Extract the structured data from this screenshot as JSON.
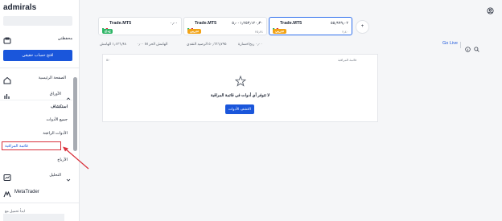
{
  "sidebar": {
    "brand": "admirals",
    "wallet_label": "محفظتي",
    "open_account_label": "افتح حساب حقيقي",
    "nav": {
      "dashboard": "الصفحة الرئيسية",
      "invest": "الأوراق",
      "subs": [
        "استكشاف",
        "جميع الأدوات",
        "الأدوات الرائجة",
        "قائمة المراقبة",
        "الأرباح"
      ],
      "analysis": "التحليل",
      "metatrader": "MetaTrader"
    },
    "footer_text": "ابدأ تحميل مع"
  },
  "tickers": [
    {
      "name": "Trade.MT5",
      "price": "٠٫٠٠",
      "badge": "إيداع",
      "badge_color": "#2fb567",
      "sub": ""
    },
    {
      "name": "Trade.MT5",
      "price": "٥٫٠٠١٫٢٥٣٫١٢٠٫٣٠",
      "badge": "تجريبي",
      "badge_color": "#f2a316",
      "sub": "٢٥٫٢٤"
    },
    {
      "name": "Trade.MT5",
      "price": "٥٥٫٩٩٩٫٠٢",
      "badge": "تجريبي",
      "badge_color": "#f2a316",
      "sub": "٢٫٤٠"
    }
  ],
  "add_ticker": "+",
  "stats": {
    "left": "١٫١٢٦٫٩٨ الهامش",
    "left_mid": "٠٫٠٠ M الهامش الحر",
    "mid": "٥٠٫٦٦٦٫٧٩٥ الرصيد النقدي",
    "right": "٠٫٠٠ ربح/خسارة"
  },
  "go_live": "Go Live",
  "panel": {
    "top_left": "٥/٠",
    "top_right": "قائمة المراقبة",
    "empty_title": "لا تتوفر أي أدوات في قائمة المراقبة",
    "browse_button": "اكتشف الأدوات"
  },
  "colors": {
    "accent": "#1a56db",
    "highlight": "#d9303a"
  }
}
